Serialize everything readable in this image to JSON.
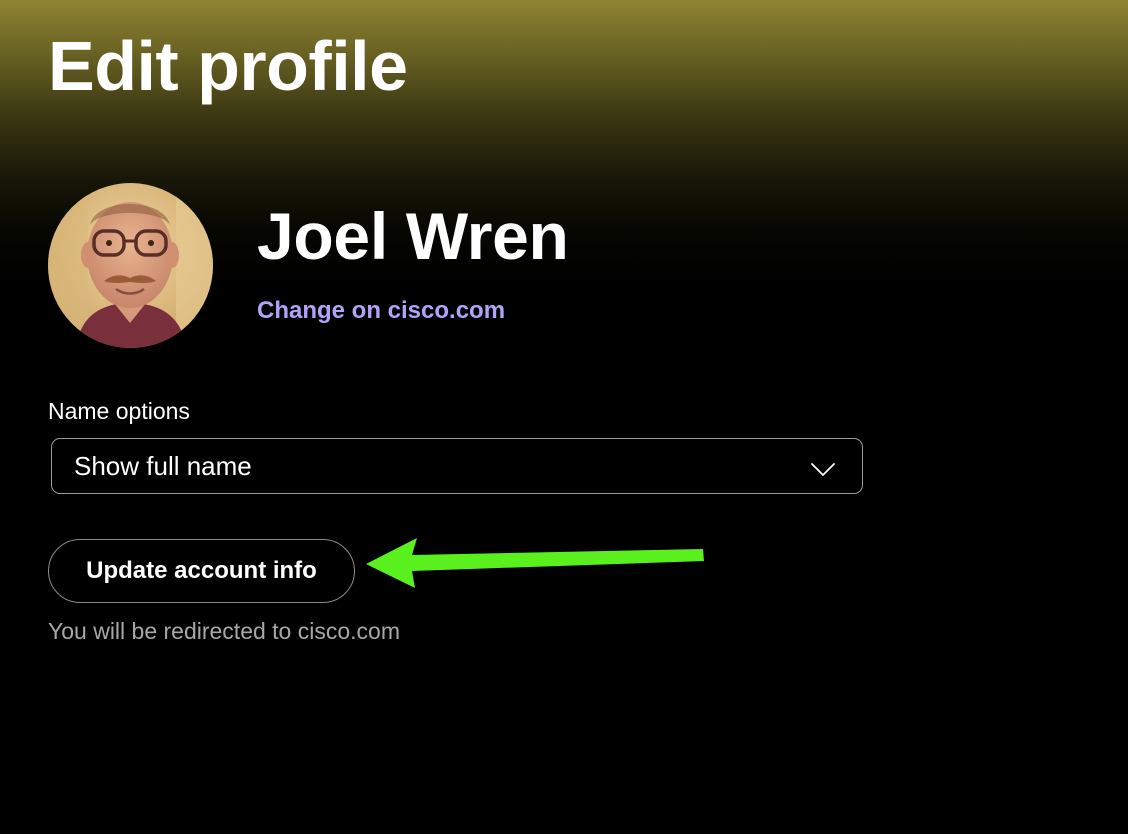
{
  "page": {
    "title": "Edit profile"
  },
  "profile": {
    "name": "Joel Wren",
    "change_link": "Change on cisco.com",
    "avatar_icon": "user-photo"
  },
  "name_options": {
    "label": "Name options",
    "selected": "Show full name",
    "icon": "chevron-down-icon"
  },
  "account": {
    "update_button": "Update account info",
    "note": "You will be redirected to cisco.com"
  },
  "annotation": {
    "type": "arrow",
    "color": "#5af01e",
    "points_to": "update-account-info-button"
  },
  "colors": {
    "link": "#b3a2f7",
    "note": "#a8a8a8",
    "background_top": "#8f8432",
    "background": "#000000"
  }
}
